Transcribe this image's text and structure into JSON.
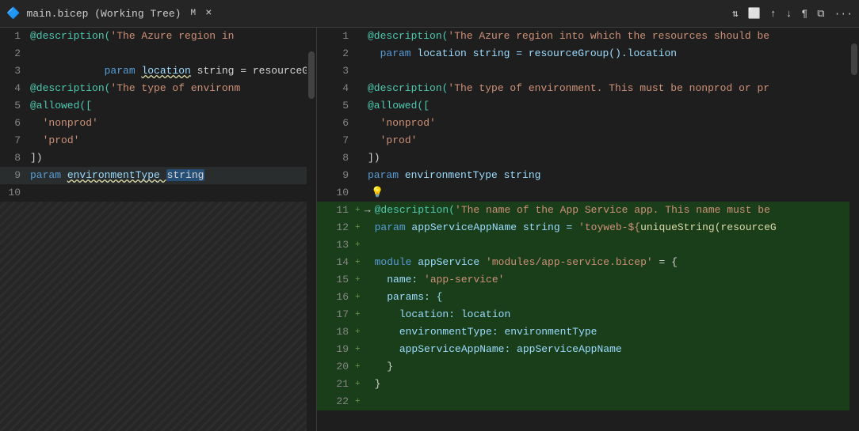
{
  "titleBar": {
    "icon": "🔷",
    "filename": "main.bicep (Working Tree)",
    "modified": "M",
    "closeLabel": "×",
    "actions": [
      "⇅",
      "⬜",
      "↑",
      "↓",
      "¶",
      "⧉",
      "···"
    ]
  },
  "leftPane": {
    "lines": [
      {
        "num": "1",
        "tokens": [
          {
            "t": "@description(",
            "c": "at"
          },
          {
            "t": "'The Azure region in",
            "c": "str"
          }
        ]
      },
      {
        "num": "2",
        "tokens": [
          {
            "t": "  param ",
            "c": "kw"
          },
          {
            "t": "location",
            "c": "squiggly-yellow light-blue"
          },
          {
            "t": " string = resourceGr",
            "c": "plain"
          }
        ]
      },
      {
        "num": "3",
        "tokens": []
      },
      {
        "num": "4",
        "tokens": [
          {
            "t": "@description(",
            "c": "at"
          },
          {
            "t": "'The type of environm",
            "c": "str"
          }
        ]
      },
      {
        "num": "5",
        "tokens": [
          {
            "t": "@allowed([",
            "c": "at"
          }
        ]
      },
      {
        "num": "6",
        "tokens": [
          {
            "t": "  ",
            "c": "plain"
          },
          {
            "t": "'nonprod'",
            "c": "str"
          }
        ]
      },
      {
        "num": "7",
        "tokens": [
          {
            "t": "  ",
            "c": "plain"
          },
          {
            "t": "'prod'",
            "c": "str"
          }
        ]
      },
      {
        "num": "8",
        "tokens": [
          {
            "t": "])",
            "c": "plain"
          }
        ]
      },
      {
        "num": "9",
        "tokens": [
          {
            "t": "param ",
            "c": "kw"
          },
          {
            "t": "environmentType ",
            "c": "light-blue"
          },
          {
            "t": "string",
            "c": "sel-bg white"
          }
        ],
        "current": true
      },
      {
        "num": "10",
        "tokens": []
      }
    ]
  },
  "rightPane": {
    "lines": [
      {
        "num": "1",
        "plus": false,
        "arrow": false,
        "deleted": false,
        "tokens": [
          {
            "t": "@description(",
            "c": "at"
          },
          {
            "t": "'The Azure region into which the resources should be",
            "c": "str"
          }
        ]
      },
      {
        "num": "2",
        "plus": false,
        "arrow": false,
        "deleted": false,
        "tokens": [
          {
            "t": "  param ",
            "c": "kw"
          },
          {
            "t": "location",
            "c": "light-blue"
          },
          {
            "t": " string = resourceGroup().location",
            "c": "plain"
          }
        ]
      },
      {
        "num": "3",
        "plus": false,
        "arrow": false,
        "deleted": false,
        "tokens": []
      },
      {
        "num": "4",
        "plus": false,
        "arrow": false,
        "deleted": false,
        "tokens": [
          {
            "t": "@description(",
            "c": "at"
          },
          {
            "t": "'The type of environment. This must be nonprod or pr",
            "c": "str"
          }
        ]
      },
      {
        "num": "5",
        "plus": false,
        "arrow": false,
        "deleted": false,
        "tokens": [
          {
            "t": "@allowed([",
            "c": "at"
          }
        ]
      },
      {
        "num": "6",
        "plus": false,
        "arrow": false,
        "deleted": false,
        "tokens": [
          {
            "t": "  ",
            "c": "plain"
          },
          {
            "t": "'nonprod'",
            "c": "str"
          }
        ]
      },
      {
        "num": "7",
        "plus": false,
        "arrow": false,
        "deleted": false,
        "tokens": [
          {
            "t": "  ",
            "c": "plain"
          },
          {
            "t": "'prod'",
            "c": "str"
          }
        ]
      },
      {
        "num": "8",
        "plus": false,
        "arrow": false,
        "deleted": false,
        "tokens": [
          {
            "t": "])",
            "c": "plain"
          }
        ]
      },
      {
        "num": "9",
        "plus": false,
        "arrow": false,
        "deleted": false,
        "tokens": [
          {
            "t": "param ",
            "c": "kw"
          },
          {
            "t": "environmentType string",
            "c": "light-blue"
          }
        ]
      },
      {
        "num": "10",
        "plus": false,
        "arrow": false,
        "deleted": false,
        "tokens": [
          {
            "t": "  💡",
            "c": "lightbulb"
          }
        ]
      },
      {
        "num": "11",
        "plus": true,
        "arrow": true,
        "deleted": false,
        "added": true,
        "tokens": [
          {
            "t": "@description(",
            "c": "at"
          },
          {
            "t": "'The name of the App Service app. This name must be",
            "c": "str"
          }
        ]
      },
      {
        "num": "12",
        "plus": true,
        "arrow": false,
        "deleted": false,
        "added": true,
        "tokens": [
          {
            "t": "param ",
            "c": "kw"
          },
          {
            "t": "appServiceAppName string = ",
            "c": "light-blue"
          },
          {
            "t": "'toyweb-${",
            "c": "str"
          },
          {
            "t": "uniqueString(resourceG",
            "c": "fn"
          }
        ]
      },
      {
        "num": "13",
        "plus": true,
        "arrow": false,
        "deleted": false,
        "added": true,
        "tokens": []
      },
      {
        "num": "14",
        "plus": true,
        "arrow": false,
        "deleted": false,
        "added": true,
        "tokens": [
          {
            "t": "module ",
            "c": "kw"
          },
          {
            "t": "appService ",
            "c": "light-blue"
          },
          {
            "t": "'modules/app-service.bicep'",
            "c": "str"
          },
          {
            "t": " = {",
            "c": "plain"
          }
        ]
      },
      {
        "num": "15",
        "plus": true,
        "arrow": false,
        "deleted": false,
        "added": true,
        "tokens": [
          {
            "t": "  name: ",
            "c": "prop"
          },
          {
            "t": "'app-service'",
            "c": "str"
          }
        ]
      },
      {
        "num": "16",
        "plus": true,
        "arrow": false,
        "deleted": false,
        "added": true,
        "tokens": [
          {
            "t": "  params: {",
            "c": "prop"
          }
        ]
      },
      {
        "num": "17",
        "plus": true,
        "arrow": false,
        "deleted": false,
        "added": true,
        "tokens": [
          {
            "t": "    location: location",
            "c": "prop"
          }
        ]
      },
      {
        "num": "18",
        "plus": true,
        "arrow": false,
        "deleted": false,
        "added": true,
        "tokens": [
          {
            "t": "    environmentType: environmentType",
            "c": "prop"
          }
        ]
      },
      {
        "num": "19",
        "plus": true,
        "arrow": false,
        "deleted": false,
        "added": true,
        "tokens": [
          {
            "t": "    appServiceAppName: appServiceAppName",
            "c": "prop"
          }
        ]
      },
      {
        "num": "20",
        "plus": true,
        "arrow": false,
        "deleted": false,
        "added": true,
        "tokens": [
          {
            "t": "  }",
            "c": "plain"
          }
        ]
      },
      {
        "num": "21",
        "plus": true,
        "arrow": false,
        "deleted": false,
        "added": true,
        "tokens": [
          {
            "t": "}",
            "c": "plain"
          }
        ]
      },
      {
        "num": "22",
        "plus": true,
        "arrow": false,
        "deleted": false,
        "added": true,
        "tokens": []
      }
    ]
  }
}
